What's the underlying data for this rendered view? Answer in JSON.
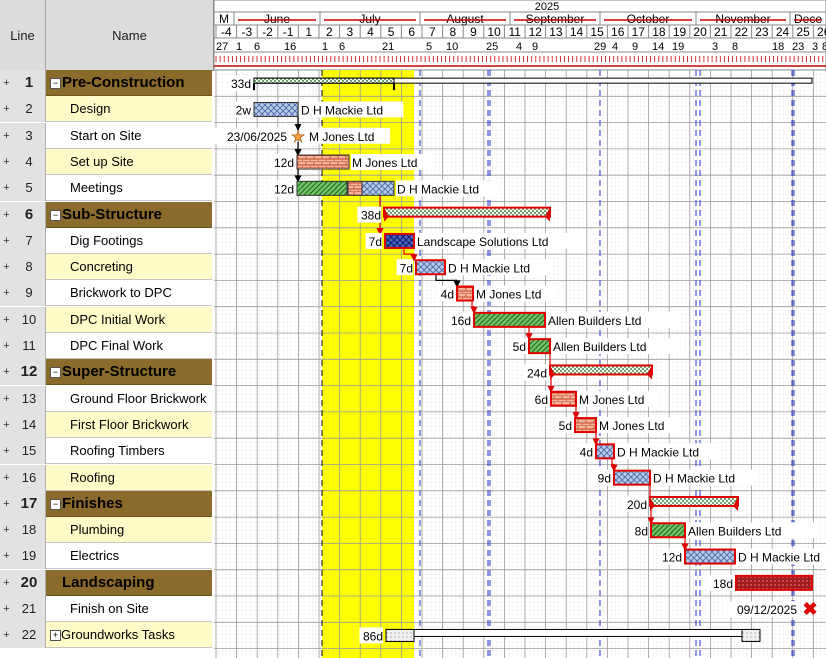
{
  "headers": {
    "line": "Line",
    "name": "Name"
  },
  "timeline": {
    "year": "2025",
    "months": [
      "M",
      "June",
      "July",
      "August",
      "September",
      "October",
      "November",
      "Dece"
    ],
    "weeks": [
      "-4",
      "-3",
      "-2",
      "-1",
      "1",
      "2",
      "3",
      "4",
      "5",
      "6",
      "7",
      "8",
      "9",
      "10",
      "11",
      "12",
      "13",
      "14",
      "15",
      "16",
      "17",
      "18",
      "19",
      "20",
      "21",
      "22",
      "23",
      "24",
      "25",
      "26"
    ],
    "dates": [
      "27",
      "1",
      "6",
      "16",
      "1",
      "6",
      "21",
      "5",
      "10",
      "25",
      "4",
      "9",
      "29",
      "4",
      "9",
      "14",
      "19",
      "3",
      "8",
      "18",
      "23",
      "3",
      "8"
    ]
  },
  "tasks": [
    {
      "line": "1",
      "name": "Pre-Construction",
      "summary": true,
      "expander": "−",
      "duration": "33d",
      "resource": ""
    },
    {
      "line": "2",
      "name": "Design",
      "duration": "2w",
      "resource": "D H Mackie Ltd"
    },
    {
      "line": "3",
      "name": "Start on Site",
      "duration": "23/06/2025",
      "resource": "M Jones Ltd",
      "milestone": true
    },
    {
      "line": "4",
      "name": "Set up Site",
      "duration": "12d",
      "resource": "M Jones Ltd"
    },
    {
      "line": "5",
      "name": "Meetings",
      "duration": "12d",
      "resource": "D H Mackie Ltd"
    },
    {
      "line": "6",
      "name": "Sub-Structure",
      "summary": true,
      "expander": "−",
      "duration": "38d",
      "resource": ""
    },
    {
      "line": "7",
      "name": "Dig Footings",
      "duration": "7d",
      "resource": "Landscape Solutions Ltd"
    },
    {
      "line": "8",
      "name": "Concreting",
      "duration": "7d",
      "resource": "D H Mackie Ltd"
    },
    {
      "line": "9",
      "name": "Brickwork to DPC",
      "duration": "4d",
      "resource": "M Jones Ltd"
    },
    {
      "line": "10",
      "name": "DPC Initial Work",
      "duration": "16d",
      "resource": "Allen Builders Ltd"
    },
    {
      "line": "11",
      "name": "DPC Final Work",
      "duration": "5d",
      "resource": "Allen Builders Ltd"
    },
    {
      "line": "12",
      "name": "Super-Structure",
      "summary": true,
      "expander": "−",
      "duration": "24d",
      "resource": ""
    },
    {
      "line": "13",
      "name": "Ground Floor Brickwork",
      "duration": "6d",
      "resource": "M Jones Ltd"
    },
    {
      "line": "14",
      "name": "First Floor Brickwork",
      "duration": "5d",
      "resource": "M Jones Ltd"
    },
    {
      "line": "15",
      "name": "Roofing Timbers",
      "duration": "4d",
      "resource": "D H Mackie Ltd"
    },
    {
      "line": "16",
      "name": "Roofing",
      "duration": "9d",
      "resource": "D H Mackie Ltd"
    },
    {
      "line": "17",
      "name": "Finishes",
      "summary": true,
      "expander": "−",
      "duration": "20d",
      "resource": ""
    },
    {
      "line": "18",
      "name": "Plumbing",
      "duration": "8d",
      "resource": "Allen Builders Ltd"
    },
    {
      "line": "19",
      "name": "Electrics",
      "duration": "12d",
      "resource": "D H Mackie Ltd"
    },
    {
      "line": "20",
      "name": "Landscaping",
      "summary": true,
      "duration": "18d",
      "resource": ""
    },
    {
      "line": "21",
      "name": "Finish on Site",
      "duration": "09/12/2025",
      "resource": "",
      "milestone": true
    },
    {
      "line": "22",
      "name": "Groundworks Tasks",
      "expander": "+",
      "duration": "86d",
      "resource": ""
    }
  ],
  "colors": {
    "summary": "#8a6b2c",
    "critical": "#e00000",
    "highlight": "#ffff00",
    "rowYellow": "#fffbc8",
    "header": "#dcdcdc"
  }
}
